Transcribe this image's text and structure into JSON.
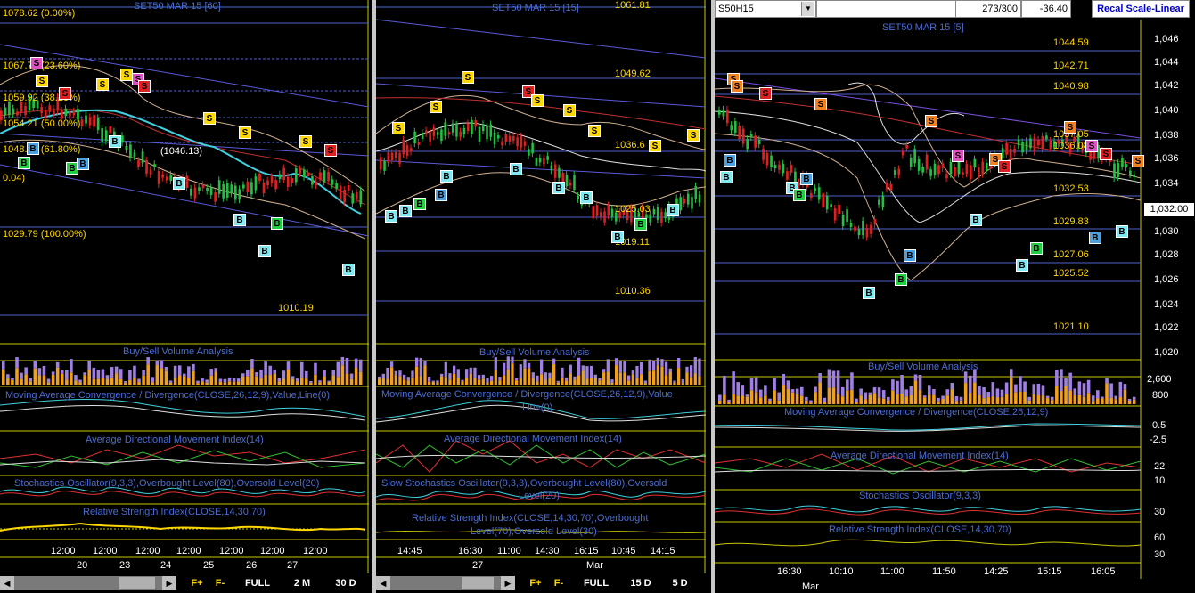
{
  "left": {
    "title": "SET50 MAR 15   [60]",
    "fib": [
      {
        "label": "1078.62 (0.00%)"
      },
      {
        "label": "1067.78 (23.60%)"
      },
      {
        "label": "1059.92 (38.20%)"
      },
      {
        "label": "1054.21 (50.00%)"
      },
      {
        "label": "1048.50 (61.80%)"
      },
      {
        "label": "1029.79 (100.00%)"
      }
    ],
    "misc_labels": [
      "(1046.13)",
      "0.04)",
      "1010.19"
    ],
    "panels": {
      "volume": "Buy/Sell Volume Analysis",
      "macd": "Moving Average Convergence / Divergence(CLOSE,26,12,9),Value,Line(0)",
      "adx": "Average Directional Movement Index(14)",
      "stoch": "Stochastics Oscillator(9,3,3),Overbought Level(80),Oversold Level(20)",
      "rsi": "Relative Strength Index(CLOSE,14,30,70)"
    },
    "time_labels": [
      "12:00",
      "12:00",
      "12:00",
      "12:00",
      "12:00",
      "12:00",
      "12:00"
    ],
    "date_labels": [
      "20",
      "23",
      "24",
      "25",
      "26",
      "27"
    ],
    "buttons": {
      "f_plus": "F+",
      "f_minus": "F-",
      "full": "FULL",
      "range1": "2 M",
      "range2": "30 D"
    }
  },
  "middle": {
    "title": "SET50 MAR 15   [15]",
    "price_labels": [
      "1061.81",
      "1049.62",
      "1036.6",
      "1025.03",
      "1019.11",
      "1010.36"
    ],
    "panels": {
      "volume": "Buy/Sell Volume Analysis",
      "macd_1": "Moving Average Convergence / Divergence(CLOSE,26,12,9),Value",
      "macd_2": "Line(0)",
      "adx": "Average Directional Movement Index(14)",
      "stoch_1": "Slow Stochastics Oscillator(9,3,3),Overbought Level(80),Oversold",
      "stoch_2": "Level(20)",
      "rsi_1": "Relative Strength Index(CLOSE,14,30,70),Overbought",
      "rsi_2": "Level(70),Oversold Level(30)"
    },
    "time_labels": [
      "14:45",
      "16:30",
      "11:00",
      "14:30",
      "16:15",
      "10:45",
      "14:15"
    ],
    "date_labels": [
      "27",
      "Mar"
    ],
    "buttons": {
      "f_plus": "F+",
      "f_minus": "F-",
      "full": "FULL",
      "range1": "15 D",
      "range2": "5 D"
    }
  },
  "right": {
    "symbol": "S50H15",
    "count": "273/300",
    "change": "-36.40",
    "scale_button": "Recal Scale-Linear",
    "title": "SET50 MAR 15   [5]",
    "price_labels": [
      "1044.59",
      "1042.71",
      "1040.98",
      "1037.05",
      "1036.08",
      "1032.53",
      "1029.83",
      "1027.06",
      "1025.52",
      "1021.10"
    ],
    "axis_ticks": [
      "1,046",
      "1,044",
      "1,042",
      "1,040",
      "1,038",
      "1,036",
      "1,034",
      "1,032.00",
      "1,030",
      "1,028",
      "1,026",
      "1,024",
      "1,022",
      "1,020"
    ],
    "current_price": "1,032.00",
    "panels": {
      "volume": "Buy/Sell Volume Analysis",
      "macd": "Moving Average Convergence / Divergence(CLOSE,26,12,9)",
      "adx": "Average Directional Movement Index(14)",
      "stoch": "Stochastics Oscillator(9,3,3)",
      "rsi": "Relative Strength Index(CLOSE,14,30,70)"
    },
    "volume_ticks": [
      "2,600",
      "800"
    ],
    "macd_ticks": [
      "0.5",
      "-2.5"
    ],
    "adx_ticks": [
      "22",
      "10"
    ],
    "stoch_ticks": [
      "30"
    ],
    "rsi_ticks": [
      "60",
      "30"
    ],
    "time_labels": [
      "16:30",
      "10:10",
      "11:00",
      "11:50",
      "14:25",
      "15:15",
      "16:05"
    ],
    "date_labels": [
      "Mar"
    ]
  },
  "colors": {
    "accent_yellow": "#ffd700",
    "panel_blue": "#4a6cd4",
    "sell_red": "#e02020",
    "buy_cyan": "#40e0f0",
    "buy_green": "#20d040",
    "price_green": "#20c040"
  }
}
